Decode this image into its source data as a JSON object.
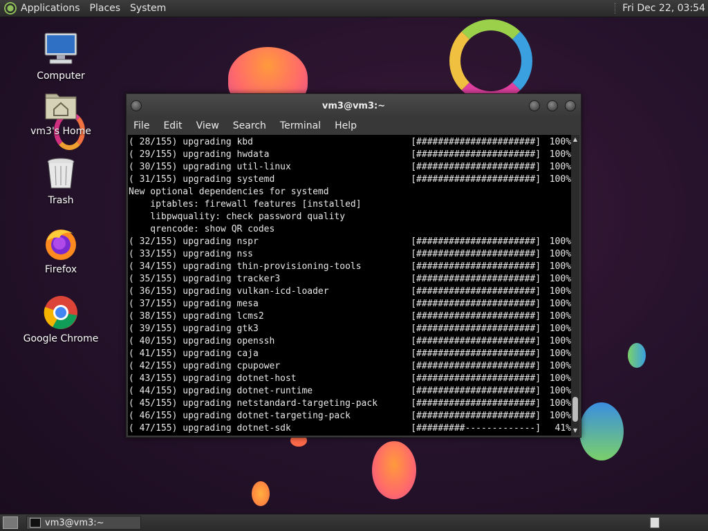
{
  "top_panel": {
    "menus": [
      "Applications",
      "Places",
      "System"
    ],
    "clock": "Fri Dec 22, 03:54"
  },
  "desktop_icons": [
    {
      "label": "Computer",
      "icon": "computer-icon"
    },
    {
      "label": "vm3's Home",
      "icon": "home-folder-icon"
    },
    {
      "label": "Trash",
      "icon": "trash-icon"
    },
    {
      "label": "Firefox",
      "icon": "firefox-icon"
    },
    {
      "label": "Google Chrome",
      "icon": "chrome-icon"
    }
  ],
  "window": {
    "title": "vm3@vm3:~",
    "menus": [
      "File",
      "Edit",
      "View",
      "Search",
      "Terminal",
      "Help"
    ],
    "terminal_lines": [
      {
        "pkg": "( 28/155) upgrading kbd",
        "bar": "[######################]",
        "pct": "100%"
      },
      {
        "pkg": "( 29/155) upgrading hwdata",
        "bar": "[######################]",
        "pct": "100%"
      },
      {
        "pkg": "( 30/155) upgrading util-linux",
        "bar": "[######################]",
        "pct": "100%"
      },
      {
        "pkg": "( 31/155) upgrading systemd",
        "bar": "[######################]",
        "pct": "100%"
      },
      {
        "pkg": "New optional dependencies for systemd",
        "bar": "",
        "pct": ""
      },
      {
        "pkg": "    iptables: firewall features [installed]",
        "bar": "",
        "pct": ""
      },
      {
        "pkg": "    libpwquality: check password quality",
        "bar": "",
        "pct": ""
      },
      {
        "pkg": "    qrencode: show QR codes",
        "bar": "",
        "pct": ""
      },
      {
        "pkg": "( 32/155) upgrading nspr",
        "bar": "[######################]",
        "pct": "100%"
      },
      {
        "pkg": "( 33/155) upgrading nss",
        "bar": "[######################]",
        "pct": "100%"
      },
      {
        "pkg": "( 34/155) upgrading thin-provisioning-tools",
        "bar": "[######################]",
        "pct": "100%"
      },
      {
        "pkg": "( 35/155) upgrading tracker3",
        "bar": "[######################]",
        "pct": "100%"
      },
      {
        "pkg": "( 36/155) upgrading vulkan-icd-loader",
        "bar": "[######################]",
        "pct": "100%"
      },
      {
        "pkg": "( 37/155) upgrading mesa",
        "bar": "[######################]",
        "pct": "100%"
      },
      {
        "pkg": "( 38/155) upgrading lcms2",
        "bar": "[######################]",
        "pct": "100%"
      },
      {
        "pkg": "( 39/155) upgrading gtk3",
        "bar": "[######################]",
        "pct": "100%"
      },
      {
        "pkg": "( 40/155) upgrading openssh",
        "bar": "[######################]",
        "pct": "100%"
      },
      {
        "pkg": "( 41/155) upgrading caja",
        "bar": "[######################]",
        "pct": "100%"
      },
      {
        "pkg": "( 42/155) upgrading cpupower",
        "bar": "[######################]",
        "pct": "100%"
      },
      {
        "pkg": "( 43/155) upgrading dotnet-host",
        "bar": "[######################]",
        "pct": "100%"
      },
      {
        "pkg": "( 44/155) upgrading dotnet-runtime",
        "bar": "[######################]",
        "pct": "100%"
      },
      {
        "pkg": "( 45/155) upgrading netstandard-targeting-pack",
        "bar": "[######################]",
        "pct": "100%"
      },
      {
        "pkg": "( 46/155) upgrading dotnet-targeting-pack",
        "bar": "[######################]",
        "pct": "100%"
      },
      {
        "pkg": "( 47/155) upgrading dotnet-sdk",
        "bar": "[#########-------------]",
        "pct": " 41%"
      }
    ]
  },
  "taskbar": {
    "task_label": "vm3@vm3:~"
  }
}
